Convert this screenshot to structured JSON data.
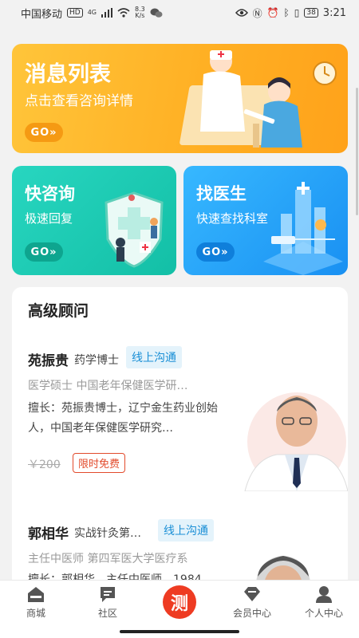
{
  "status_bar": {
    "carrier": "中国移动",
    "hd": "HD",
    "net": "4G",
    "speed_value": "8.3",
    "speed_unit": "K/s",
    "battery": "38",
    "time": "3:21"
  },
  "banner_main": {
    "title": "消息列表",
    "subtitle": "点击查看咨询详情",
    "go_label": "GO»"
  },
  "card_quick": {
    "title": "快咨询",
    "subtitle": "极速回复",
    "go_label": "GO»"
  },
  "card_doctor": {
    "title": "找医生",
    "subtitle": "快速查找科室",
    "go_label": "GO»"
  },
  "consultants": {
    "heading": "高级顾问",
    "items": [
      {
        "name": "苑振贵",
        "title": "药学博士",
        "tag": "线上沟通",
        "line1": "医学硕士  中国老年保健医学研…",
        "specialty": "擅长：苑振贵博士，辽宁金生药业创始人，中国老年保健医学研究…",
        "price": "￥200",
        "badge": "限时免费"
      },
      {
        "name": "郭相华",
        "title": "实战针灸第…",
        "tag": "线上沟通",
        "line1": "主任中医师  第四军医大学医疗系",
        "specialty": "擅长：郭相华，主任中医师，1984"
      }
    ]
  },
  "bottom_nav": {
    "items": [
      {
        "label": "商城",
        "icon": "home-icon"
      },
      {
        "label": "社区",
        "icon": "community-icon"
      },
      {
        "label": "测",
        "icon": "test-center-icon"
      },
      {
        "label": "会员中心",
        "icon": "member-icon"
      },
      {
        "label": "个人中心",
        "icon": "profile-icon"
      }
    ]
  },
  "colors": {
    "orange_card": "#ffb024",
    "teal_card": "#13bfa6",
    "blue_card": "#1990f2",
    "accent_red": "#ee3b22",
    "tag_blue": "#1a8fd6"
  }
}
